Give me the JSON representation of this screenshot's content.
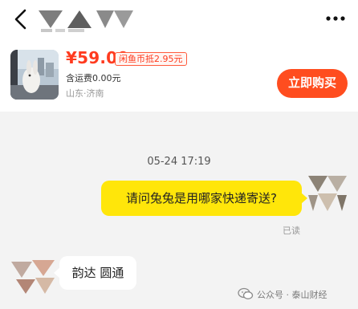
{
  "product": {
    "price": "¥59.00",
    "coin_badge": "闲鱼币抵2.95元",
    "shipping": "含运费0.00元",
    "location": "山东·济南",
    "buy_label": "立即购买"
  },
  "chat": {
    "timestamp": "05-24 17:19",
    "messages": [
      {
        "from": "self",
        "text": "请问兔兔是用哪家快递寄送?",
        "status": "已读"
      },
      {
        "from": "peer",
        "text": "韵达 圆通"
      }
    ]
  },
  "watermark": {
    "text": "公众号 · 泰山财经"
  },
  "icons": {
    "back": "chevron-left-icon",
    "more": "more-dots-icon",
    "watermark": "wechat-icon"
  },
  "colors": {
    "accent": "#ff4d1f",
    "price": "#ff3b1f",
    "outgoing_bubble": "#ffe60a",
    "chat_bg": "#f3f3f3"
  }
}
